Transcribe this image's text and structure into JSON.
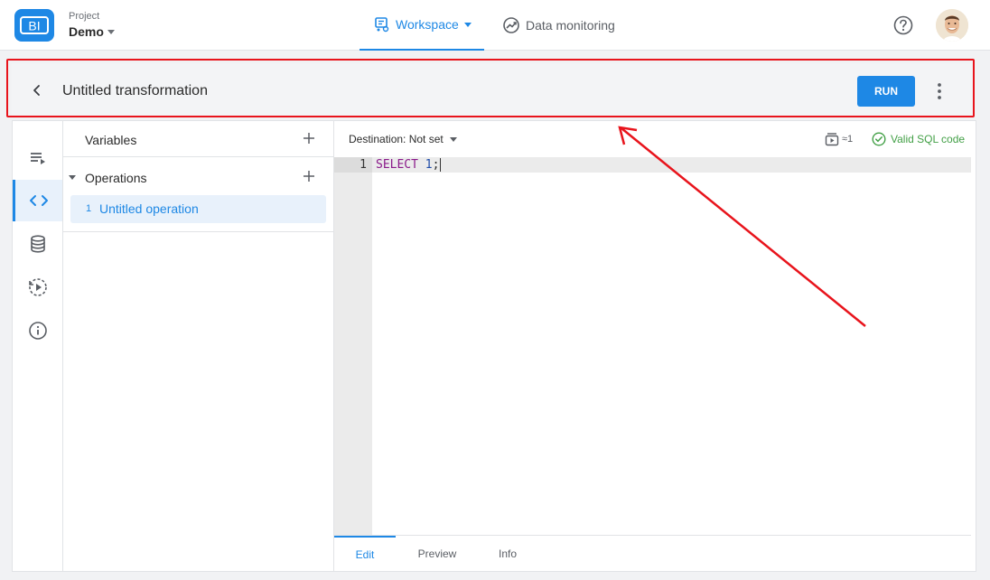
{
  "header": {
    "logo_text": "BI",
    "project_label": "Project",
    "project_name": "Demo",
    "nav": [
      {
        "label": "Workspace",
        "active": true,
        "icon": "workspace-icon"
      },
      {
        "label": "Data monitoring",
        "active": false,
        "icon": "monitoring-icon"
      }
    ],
    "help_icon": "help-icon",
    "avatar": "user-avatar"
  },
  "transformation": {
    "title": "Untitled transformation",
    "run_label": "RUN"
  },
  "sidebar_rail": [
    {
      "icon": "playlist-icon",
      "active": false
    },
    {
      "icon": "code-icon",
      "active": true
    },
    {
      "icon": "database-icon",
      "active": false
    },
    {
      "icon": "schedule-icon",
      "active": false
    },
    {
      "icon": "info-icon",
      "active": false
    }
  ],
  "tree": {
    "variables_label": "Variables",
    "operations_label": "Operations",
    "operations": [
      {
        "index": "1",
        "label": "Untitled operation"
      }
    ]
  },
  "editor": {
    "destination_label": "Destination: Not set",
    "rows_estimate": "≈1",
    "validity_label": "Valid SQL code",
    "lines": [
      {
        "number": "1",
        "keyword": "SELECT",
        "value": "1",
        "terminator": ";"
      }
    ],
    "tabs": [
      "Edit",
      "Preview",
      "Info"
    ]
  },
  "colors": {
    "accent": "#1e88e5",
    "valid": "#43a047",
    "annotation": "#e8141c"
  }
}
